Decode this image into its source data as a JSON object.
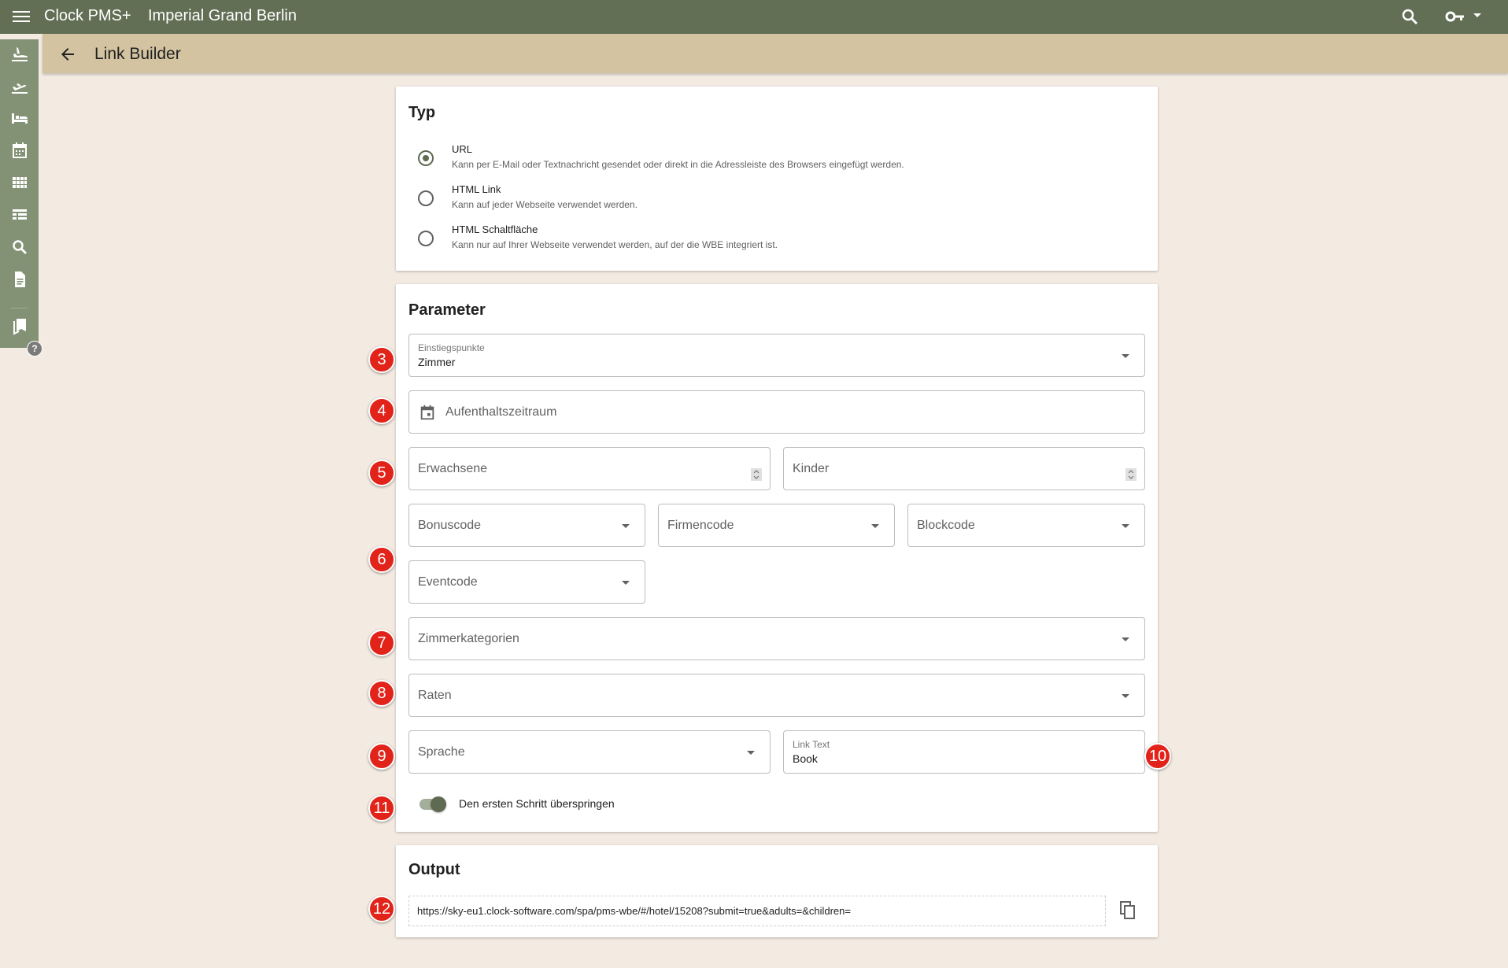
{
  "app": {
    "name": "Clock PMS+",
    "hotel": "Imperial Grand Berlin"
  },
  "header": {
    "title": "Link Builder"
  },
  "typ": {
    "title": "Typ",
    "options": [
      {
        "label": "URL",
        "description": "Kann per E-Mail oder Textnachricht gesendet oder direkt in die Adressleiste des Browsers eingefügt werden.",
        "selected": true
      },
      {
        "label": "HTML Link",
        "description": "Kann auf jeder Webseite verwendet werden.",
        "selected": false
      },
      {
        "label": "HTML Schaltfläche",
        "description": "Kann nur auf Ihrer Webseite verwendet werden, auf der die WBE integriert ist.",
        "selected": false
      }
    ]
  },
  "parameter": {
    "title": "Parameter",
    "entry_point": {
      "label": "Einstiegspunkte",
      "value": "Zimmer"
    },
    "stay_period": {
      "placeholder": "Aufenthaltszeitraum"
    },
    "adults": {
      "placeholder": "Erwachsene"
    },
    "children": {
      "placeholder": "Kinder"
    },
    "bonus_code": {
      "placeholder": "Bonuscode"
    },
    "company_code": {
      "placeholder": "Firmencode"
    },
    "block_code": {
      "placeholder": "Blockcode"
    },
    "event_code": {
      "placeholder": "Eventcode"
    },
    "room_categories": {
      "placeholder": "Zimmerkategorien"
    },
    "rates": {
      "placeholder": "Raten"
    },
    "language": {
      "placeholder": "Sprache"
    },
    "link_text": {
      "label": "Link Text",
      "value": "Book"
    },
    "skip_first_step": {
      "label": "Den ersten Schritt überspringen",
      "enabled": true
    }
  },
  "output": {
    "title": "Output",
    "url": "https://sky-eu1.clock-software.com/spa/pms-wbe/#/hotel/15208?submit=true&adults=&children="
  },
  "markers": [
    "3",
    "4",
    "5",
    "6",
    "7",
    "8",
    "9",
    "10",
    "11",
    "12"
  ],
  "sidebar": {
    "icons": [
      "arrivals-icon",
      "departures-icon",
      "rooms-icon",
      "calendar-icon",
      "grid-icon",
      "list-icon",
      "search-icon",
      "document-icon",
      "bookmarks-icon"
    ],
    "help": "?"
  },
  "colors": {
    "topbar": "#626f55",
    "subheader": "#d3c3a1",
    "sidebar": "#839275",
    "accent": "#5e6a51",
    "background": "#f3ebe2",
    "marker": "#e2231a"
  }
}
